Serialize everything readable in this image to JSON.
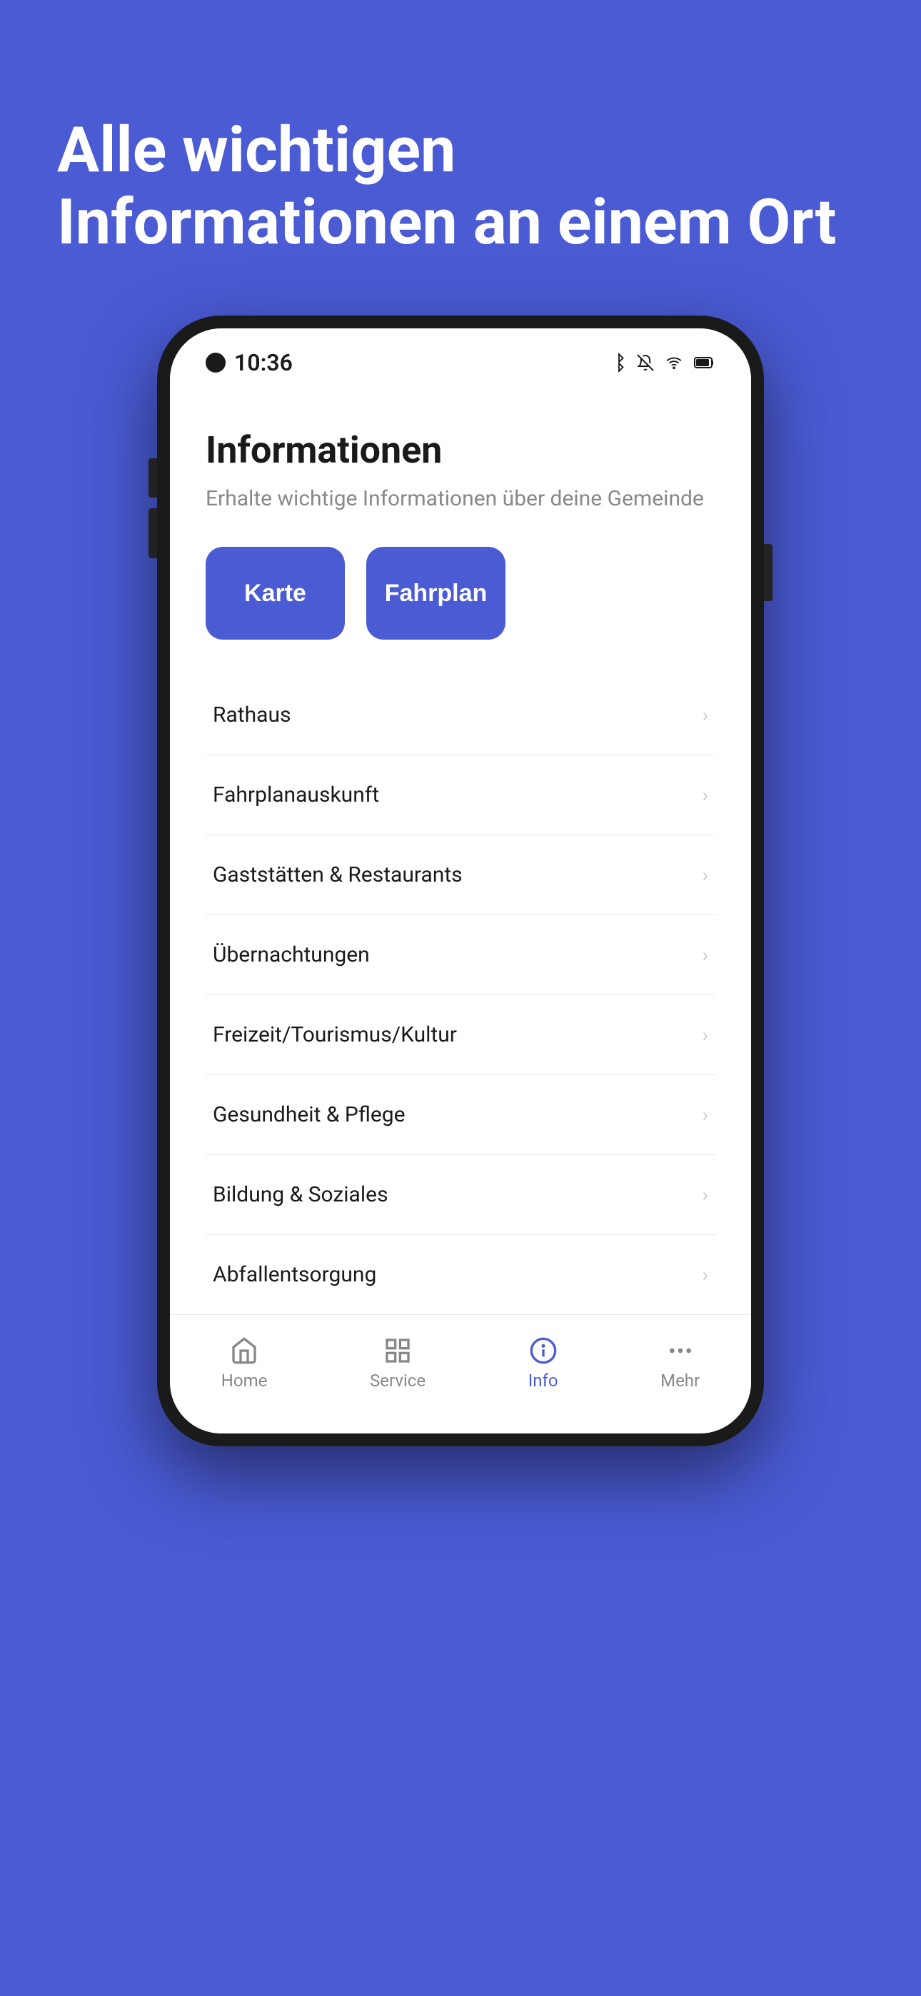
{
  "background_color": "#4a5bd4",
  "hero": {
    "title": "Alle wichtigen Informationen an einem Ort"
  },
  "phone": {
    "status_bar": {
      "time": "10:36",
      "icons": [
        "bluetooth",
        "bell-off",
        "wifi",
        "battery"
      ]
    },
    "app": {
      "title": "Informationen",
      "subtitle": "Erhalte wichtige Informationen über deine Gemeinde",
      "quick_actions": [
        {
          "label": "Karte"
        },
        {
          "label": "Fahrplan"
        }
      ],
      "list_items": [
        {
          "label": "Rathaus"
        },
        {
          "label": "Fahrplanauskunft"
        },
        {
          "label": "Gaststätten & Restaurants"
        },
        {
          "label": "Übernachtungen"
        },
        {
          "label": "Freizeit/Tourismus/Kultur"
        },
        {
          "label": "Gesundheit & Pflege"
        },
        {
          "label": "Bildung & Soziales"
        },
        {
          "label": "Abfallentsorgung"
        }
      ]
    },
    "bottom_nav": [
      {
        "label": "Home",
        "icon": "home",
        "active": false
      },
      {
        "label": "Service",
        "icon": "grid",
        "active": false
      },
      {
        "label": "Info",
        "icon": "info-circle",
        "active": true
      },
      {
        "label": "Mehr",
        "icon": "dots",
        "active": false
      }
    ]
  }
}
